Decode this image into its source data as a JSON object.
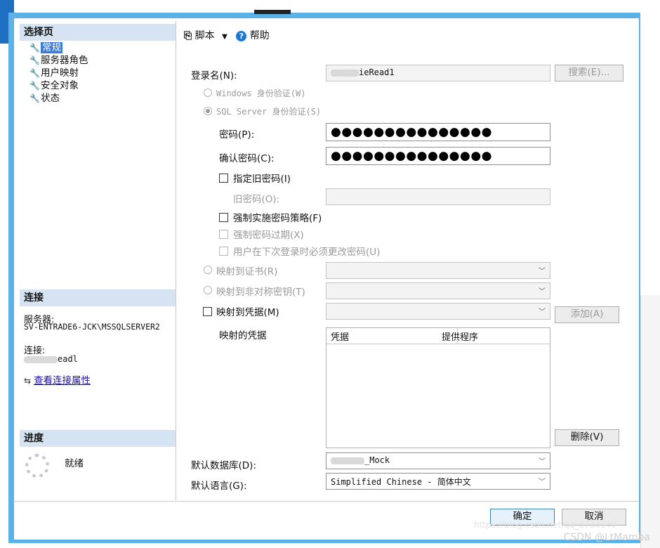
{
  "toolbar": {
    "script_label": "脚本",
    "help_label": "帮助"
  },
  "left": {
    "select_page_title": "选择页",
    "nav": [
      "常规",
      "服务器角色",
      "用户映射",
      "安全对象",
      "状态"
    ],
    "connection_title": "连接",
    "server_label": "服务器:",
    "server_value": "SV-ENTRADE6-JCK\\MSSQLSERVER2",
    "connection_label": "连接:",
    "connection_value": "eadl",
    "view_props_link": "查看连接属性",
    "progress_title": "进度",
    "progress_status": "就绪"
  },
  "form": {
    "login_name_label": "登录名(N):",
    "login_name_value": "ieRead1",
    "search_button": "搜索(E)...",
    "windows_auth": "Windows 身份验证(W)",
    "sql_auth": "SQL Server 身份验证(S)",
    "password_label": "密码(P):",
    "password_value": "●●●●●●●●●●●●●●●",
    "confirm_label": "确认密码(C):",
    "confirm_value": "●●●●●●●●●●●●●●●",
    "specify_old_pw": "指定旧密码(I)",
    "old_pw_label": "旧密码(O):",
    "enforce_policy": "强制实施密码策略(F)",
    "enforce_expiration": "强制密码过期(X)",
    "must_change": "用户在下次登录时必须更改密码(U)",
    "map_cert": "映射到证书(R)",
    "map_asym_key": "映射到非对称密钥(T)",
    "map_credential": "映射到凭据(M)",
    "add_button": "添加(A)",
    "mapped_credentials_label": "映射的凭据",
    "grid_col_credential": "凭据",
    "grid_col_provider": "提供程序",
    "remove_button": "删除(V)",
    "default_db_label": "默认数据库(D):",
    "default_db_value": "_Mock",
    "default_lang_label": "默认语言(G):",
    "default_lang_value": "Simplified Chinese - 简体中文"
  },
  "footer": {
    "ok_button": "确定",
    "cancel_button": "取消"
  },
  "watermark": "CSDN @LtMamba",
  "watermark_url": "https://blog.csdn.net/qq_3733340",
  "colors": {
    "selected_nav": "#3a7bd5",
    "section_header": "#d6e3f2",
    "frame_blue": "#5bb2e8",
    "link": "#1a0dab"
  }
}
